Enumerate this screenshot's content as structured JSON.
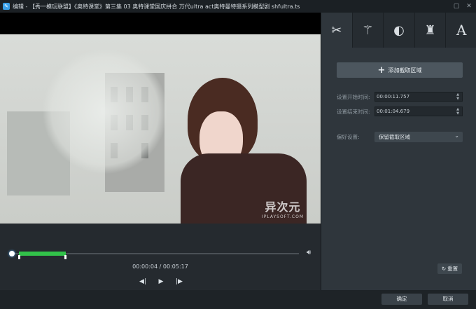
{
  "window": {
    "title": "编辑 - 【秀一模玩联盟】《奥特课堂》第三集 03 奥特课堂国庆拼合 万代ultra act奥特曼特摄系列模型剧 shfultra.ts",
    "app_icon": "edit-app-icon",
    "controls": {
      "restore_icon": "restore-icon",
      "close_icon": "close-icon"
    }
  },
  "preview": {
    "watermark_main": "异次元",
    "watermark_sub": "IPLAYSOFT.COM"
  },
  "playback": {
    "timecode": "00:00:04 / 00:05:17",
    "selection_start_fraction": 0.024,
    "selection_end_fraction": 0.188,
    "position_fraction": 0.0
  },
  "panel": {
    "tabs": [
      {
        "name": "trim",
        "icon": "scissors-icon"
      },
      {
        "name": "effects",
        "icon": "magic-wand-icon"
      },
      {
        "name": "adjust",
        "icon": "brightness-icon"
      },
      {
        "name": "watermark",
        "icon": "stamp-icon"
      },
      {
        "name": "text",
        "icon": "text-icon",
        "glyph": "A"
      }
    ],
    "add_button_label": "添加截取区域",
    "start_label": "设置开始时间:",
    "start_value": "00:00:11.757",
    "end_label": "设置结束时间:",
    "end_value": "00:01:04.679",
    "pref_label": "偏好设置:",
    "pref_value": "保留截取区域",
    "reset_label": "重置"
  },
  "footer": {
    "ok_label": "确定",
    "cancel_label": "取消"
  },
  "colors": {
    "accent_green": "#32c24a",
    "panel_bg": "#2f363c",
    "background": "#1e2327"
  }
}
